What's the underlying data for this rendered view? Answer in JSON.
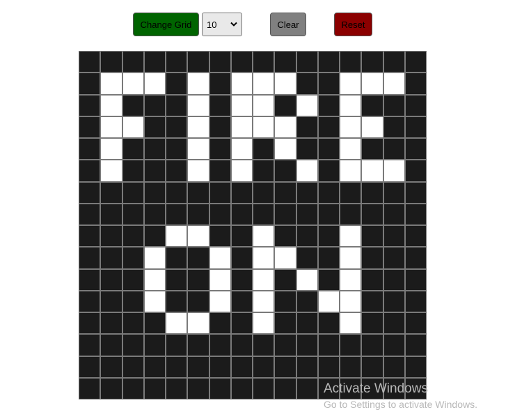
{
  "toolbar": {
    "change_grid_label": "Change Grid",
    "grid_size_selected": "10",
    "clear_label": "Clear",
    "reset_label": "Reset"
  },
  "colors": {
    "change_grid_bg": "#006400",
    "clear_bg": "#808080",
    "reset_bg": "#8b0000",
    "cell_off": "#1b1b1b",
    "cell_on": "#ffffff",
    "grid_line": "#7a7a7a"
  },
  "grid": {
    "rows": 16,
    "cols": 16,
    "cells": [
      "0000000000000000",
      "0111010111001110",
      "0100010110101000",
      "0110010111001100",
      "0100010101001000",
      "0100010100101110",
      "0000000000000000",
      "0000000000000000",
      "0000110010001000",
      "0001001011001000",
      "0001001010101000",
      "0001001010011000",
      "0000110010001000",
      "0000000000000000",
      "0000000000000000",
      "0000000000000000"
    ]
  },
  "watermark": {
    "title": "Activate Windows",
    "subtitle": "Go to Settings to activate Windows."
  }
}
